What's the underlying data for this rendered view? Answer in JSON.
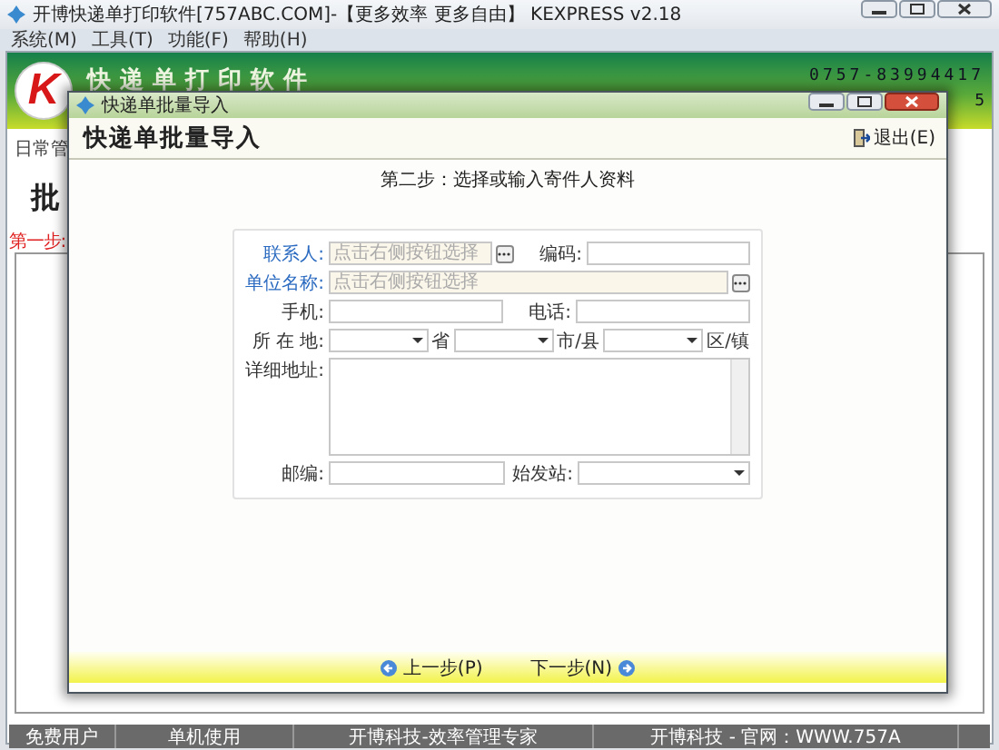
{
  "main_window": {
    "title": "开博快递单打印软件[757ABC.COM]-【更多效率 更多自由】 KEXPRESS v2.18",
    "menu": [
      "系统(M)",
      "工具(T)",
      "功能(F)",
      "帮助(H)"
    ],
    "logo_letter": "K",
    "banner_title": "快递单打印软件",
    "phone": "0757-83994417",
    "phone_line2": "5",
    "tab": "日常管",
    "heading": "批",
    "step_label": "第一步:"
  },
  "dialog": {
    "title": "快递单批量导入",
    "heading": "快递单批量导入",
    "exit_button": "退出(E)",
    "step": "第二步：选择或输入寄件人资料",
    "rows": [
      {
        "items": [
          {
            "kind": "label",
            "text": "联系人:",
            "required": true
          },
          {
            "kind": "picker",
            "placeholder": "点击右侧按钮选择"
          },
          {
            "kind": "label",
            "text": "编码:",
            "required": false
          },
          {
            "kind": "input"
          }
        ]
      },
      {
        "items": [
          {
            "kind": "label",
            "text": "单位名称:",
            "required": true
          },
          {
            "kind": "picker",
            "placeholder": "点击右侧按钮选择"
          }
        ]
      },
      {
        "items": [
          {
            "kind": "label",
            "text": "手机:",
            "required": false
          },
          {
            "kind": "input"
          },
          {
            "kind": "label",
            "text": "电话:",
            "required": false
          },
          {
            "kind": "input"
          }
        ]
      },
      {
        "items": [
          {
            "kind": "label",
            "text": "所 在 地:",
            "required": false
          },
          {
            "kind": "select"
          },
          {
            "kind": "label",
            "text": "省",
            "required": false
          },
          {
            "kind": "select"
          },
          {
            "kind": "label",
            "text": "市/县",
            "required": false
          },
          {
            "kind": "select"
          },
          {
            "kind": "label",
            "text": "区/镇",
            "required": false
          }
        ]
      },
      {
        "items": [
          {
            "kind": "label",
            "text": "详细地址:",
            "required": false
          },
          {
            "kind": "textarea"
          }
        ]
      },
      {
        "items": [
          {
            "kind": "label",
            "text": "邮编:",
            "required": false
          },
          {
            "kind": "input"
          },
          {
            "kind": "label",
            "text": "始发站:",
            "required": false
          },
          {
            "kind": "select"
          }
        ]
      }
    ],
    "prev_button": "上一步(P)",
    "next_button": "下一步(N)"
  },
  "status_bar": [
    "免费用户",
    "单机使用",
    "开博科技-效率管理专家",
    "开博科技 - 官网：WWW.757A"
  ]
}
